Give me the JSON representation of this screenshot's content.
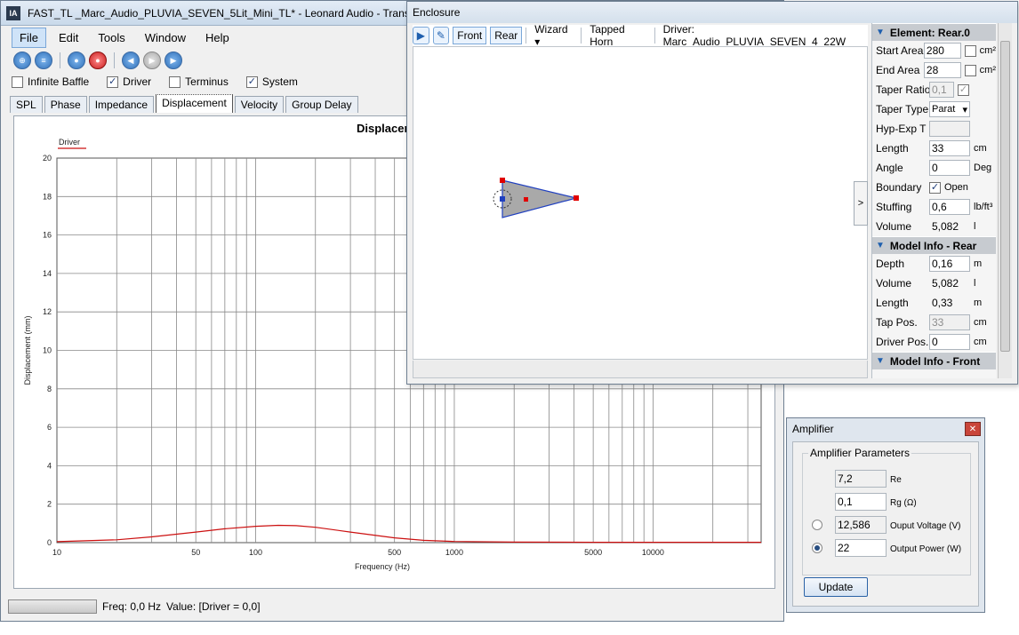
{
  "main_window": {
    "title": "FAST_TL _Marc_Audio_PLUVIA_SEVEN_5Lit_Mini_TL* - Leonard Audio - Transmiss",
    "logo": "lA",
    "menu": [
      "File",
      "Edit",
      "Tools",
      "Window",
      "Help"
    ],
    "toolbar_icons": [
      "new-icon",
      "open-icon",
      "play-icon",
      "record-icon",
      "back-icon",
      "pause-icon",
      "forward-icon"
    ],
    "checkboxes": [
      {
        "label": "Infinite Baffle",
        "checked": false
      },
      {
        "label": "Driver",
        "checked": true
      },
      {
        "label": "Terminus",
        "checked": false
      },
      {
        "label": "System",
        "checked": true
      }
    ],
    "tabs": [
      "SPL",
      "Phase",
      "Impedance",
      "Displacement",
      "Velocity",
      "Group Delay"
    ],
    "active_tab": "Displacement",
    "status": {
      "freq": "Freq: 0,0 Hz",
      "value": "Value: [Driver = 0,0]"
    }
  },
  "chart_data": {
    "type": "line",
    "title": "Displacer",
    "xlabel": "Frequency (Hz)",
    "ylabel": "Displacement (mm)",
    "x_scale": "log",
    "xlim": [
      10,
      35000
    ],
    "ylim": [
      0,
      20
    ],
    "x_tick_labels": [
      "10",
      "50",
      "100",
      "500",
      "1000",
      "5000",
      "10000"
    ],
    "y_tick_labels": [
      "0",
      "2",
      "4",
      "6",
      "8",
      "10",
      "12",
      "14",
      "16",
      "18",
      "20"
    ],
    "legend": "top-left",
    "grid": true,
    "series_color": "#cc1010",
    "series": [
      {
        "name": "Driver",
        "x": [
          10,
          20,
          30,
          50,
          70,
          100,
          130,
          160,
          200,
          300,
          500,
          700,
          1000,
          2000,
          5000,
          10000,
          35000
        ],
        "values": [
          0.05,
          0.15,
          0.3,
          0.55,
          0.72,
          0.85,
          0.9,
          0.88,
          0.8,
          0.55,
          0.25,
          0.12,
          0.06,
          0.03,
          0.02,
          0.02,
          0.02
        ]
      }
    ]
  },
  "enclosure": {
    "title": "Enclosure",
    "toolbar": {
      "front": "Front",
      "rear": "Rear",
      "wizard": "Wizard",
      "tapped_horn": "Tapped Horn",
      "driver": "Driver: Marc_Audio_PLUVIA_SEVEN_4_22W"
    },
    "collapse_glyph": ">",
    "element_section": "Element: Rear.0",
    "props": {
      "start_area": {
        "label": "Start Area",
        "value": "280",
        "unit": "cm²"
      },
      "end_area": {
        "label": "End Area",
        "value": "28",
        "unit": "cm²"
      },
      "taper_ratio": {
        "label": "Taper Ratio",
        "value": "0,1"
      },
      "taper_type": {
        "label": "Taper Type",
        "value": "Parat"
      },
      "hyp_exp": {
        "label": "Hyp-Exp T",
        "value": ""
      },
      "length": {
        "label": "Length",
        "value": "33",
        "unit": "cm"
      },
      "angle": {
        "label": "Angle",
        "value": "0",
        "unit": "Deg"
      },
      "boundary": {
        "label": "Boundary",
        "option": "Open"
      },
      "stuffing": {
        "label": "Stuffing",
        "value": "0,6",
        "unit": "lb/ft³"
      },
      "volume": {
        "label": "Volume",
        "value": "5,082",
        "unit": "l"
      }
    },
    "model_rear_section": "Model Info - Rear",
    "model_rear": {
      "depth": {
        "label": "Depth",
        "value": "0,16",
        "unit": "m"
      },
      "volume": {
        "label": "Volume",
        "value": "5,082",
        "unit": "l"
      },
      "length": {
        "label": "Length",
        "value": "0,33",
        "unit": "m"
      },
      "tap_pos": {
        "label": "Tap Pos.",
        "value": "33",
        "unit": "cm"
      },
      "driver_pos": {
        "label": "Driver Pos.",
        "value": "0",
        "unit": "cm"
      }
    },
    "model_front_section": "Model Info - Front"
  },
  "amplifier": {
    "title": "Amplifier",
    "close_glyph": "✕",
    "group_title": "Amplifier Parameters",
    "re": {
      "value": "7,2",
      "label": "Re"
    },
    "rg": {
      "value": "0,1",
      "label": "Rg (Ω)"
    },
    "voltage": {
      "value": "12,586",
      "label": "Ouput Voltage (V)"
    },
    "power": {
      "value": "22",
      "label": "Output Power (W)"
    },
    "selected_mode": "power",
    "update_label": "Update"
  }
}
